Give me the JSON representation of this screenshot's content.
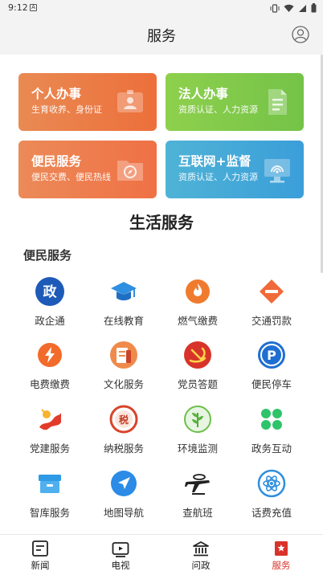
{
  "status_bar": {
    "time": "9:12"
  },
  "header": {
    "title": "服务"
  },
  "cards": [
    {
      "title": "个人办事",
      "subtitle": "生育收养、身份证",
      "icon": "id-card-icon"
    },
    {
      "title": "法人办事",
      "subtitle": "资质认证、人力资源",
      "icon": "document-icon"
    },
    {
      "title": "便民服务",
      "subtitle": "便民交费、便民热线",
      "icon": "folder-compass-icon"
    },
    {
      "title": "互联网+监督",
      "subtitle": "资质认证、人力资源",
      "icon": "monitor-icon"
    }
  ],
  "section_title": "生活服务",
  "group_title": "便民服务",
  "services": [
    {
      "label": "政企通",
      "icon": "zheng-icon"
    },
    {
      "label": "在线教育",
      "icon": "graduation-cap-icon"
    },
    {
      "label": "燃气缴费",
      "icon": "flame-icon"
    },
    {
      "label": "交通罚款",
      "icon": "no-entry-icon"
    },
    {
      "label": "电费缴费",
      "icon": "lightning-icon"
    },
    {
      "label": "文化服务",
      "icon": "book-icon"
    },
    {
      "label": "党员答题",
      "icon": "party-emblem-icon"
    },
    {
      "label": "便民停车",
      "icon": "parking-icon"
    },
    {
      "label": "党建服务",
      "icon": "party-flag-icon"
    },
    {
      "label": "纳税服务",
      "icon": "tax-icon"
    },
    {
      "label": "环境监测",
      "icon": "leaf-icon"
    },
    {
      "label": "政务互动",
      "icon": "clover-icon"
    },
    {
      "label": "智库服务",
      "icon": "archive-box-icon"
    },
    {
      "label": "地图导航",
      "icon": "navigation-arrow-icon"
    },
    {
      "label": "查航班",
      "icon": "airplane-icon"
    },
    {
      "label": "话费充值",
      "icon": "atom-icon"
    }
  ],
  "tabs": [
    {
      "label": "新闻",
      "icon": "news-icon"
    },
    {
      "label": "电视",
      "icon": "tv-icon"
    },
    {
      "label": "问政",
      "icon": "government-building-icon"
    },
    {
      "label": "服务",
      "icon": "service-bookmark-icon"
    }
  ],
  "colors": {
    "accent": "#d8332a",
    "orange": "#ef7a45",
    "green": "#7cc84a",
    "blue": "#3d9fd9"
  }
}
